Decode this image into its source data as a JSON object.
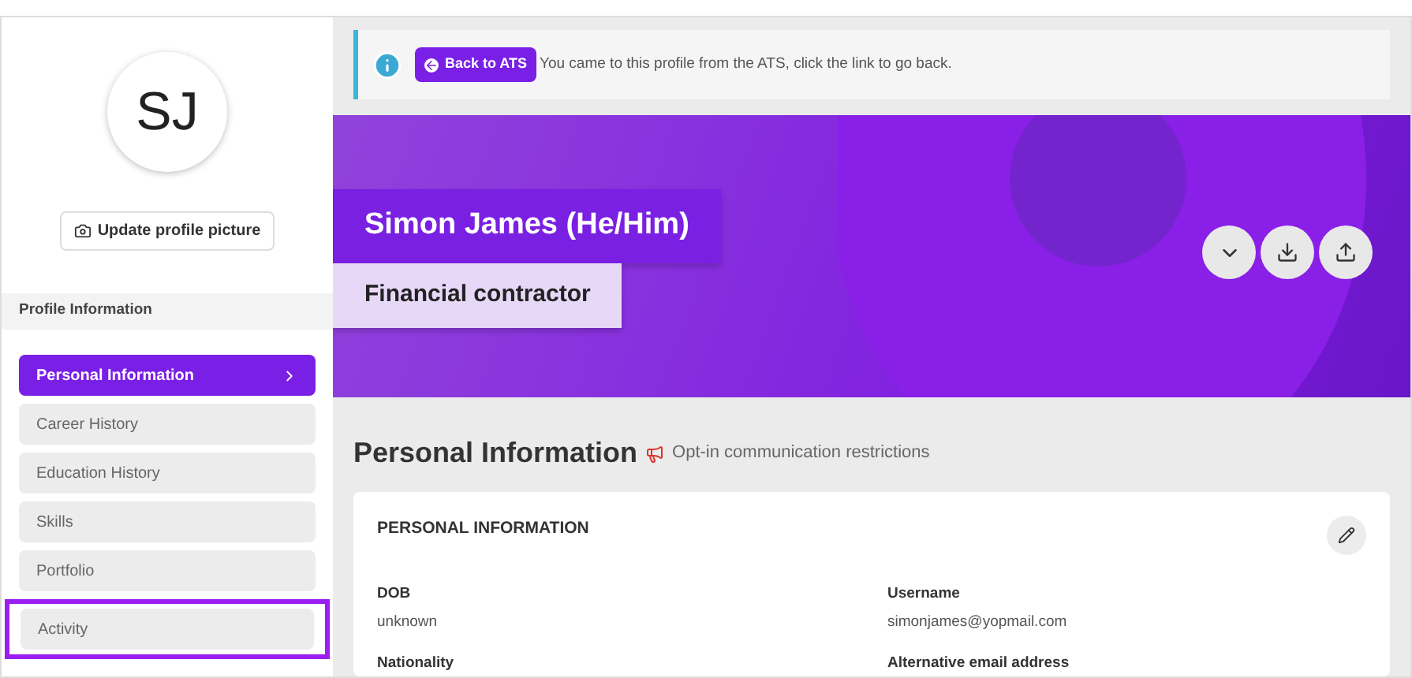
{
  "profile": {
    "initials": "SJ",
    "update_button": "Update profile picture"
  },
  "sidebar": {
    "heading": "Profile Information",
    "items": [
      {
        "label": "Personal Information",
        "selected": true,
        "highlighted": false
      },
      {
        "label": "Career History",
        "selected": false,
        "highlighted": false
      },
      {
        "label": "Education History",
        "selected": false,
        "highlighted": false
      },
      {
        "label": "Skills",
        "selected": false,
        "highlighted": false
      },
      {
        "label": "Portfolio",
        "selected": false,
        "highlighted": false
      },
      {
        "label": "Activity",
        "selected": false,
        "highlighted": true
      }
    ]
  },
  "notice": {
    "button": "Back to ATS",
    "message": "You came to this profile from the ATS, click the link to go back."
  },
  "banner": {
    "name": "Simon James (He/Him)",
    "job_title": "Financial contractor"
  },
  "section": {
    "title": "Personal Information",
    "restriction": "Opt-in communication restrictions"
  },
  "card": {
    "title": "PERSONAL INFORMATION",
    "fields": [
      {
        "label": "DOB",
        "value": "unknown"
      },
      {
        "label": "Username",
        "value": "simonjames@yopmail.com"
      },
      {
        "label": "Nationality"
      },
      {
        "label": "Alternative email address"
      }
    ]
  }
}
